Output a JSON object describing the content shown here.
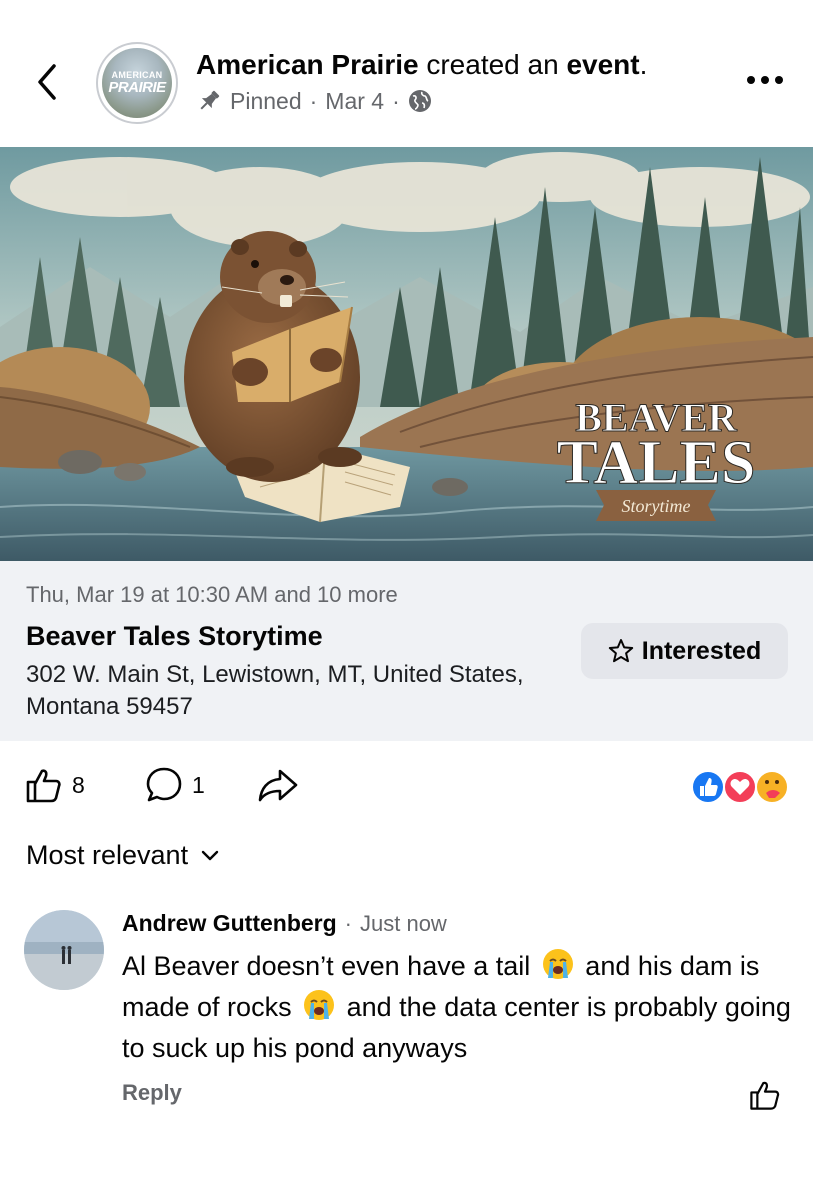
{
  "header": {
    "page_name": "American Prairie",
    "action_text": " created an ",
    "action_object": "event",
    "action_end": ".",
    "avatar_text_top": "AMERICAN",
    "avatar_text_main": "PRAIRIE",
    "pinned_label": "Pinned",
    "date": "Mar 4",
    "separator": "·",
    "privacy_icon": "globe-icon",
    "back_icon": "chevron-left-icon",
    "more_icon": "more-horizontal-icon"
  },
  "banner": {
    "title_line1": "BEAVER",
    "title_line2": "TALES",
    "ribbon_text": "Storytime"
  },
  "event": {
    "date_text": "Thu, Mar 19 at 10:30 AM and 10 more",
    "title": "Beaver Tales Storytime",
    "address": "302 W. Main St, Lewistown, MT, United States, Montana 59457",
    "interested_label": "Interested",
    "interested_icon": "star-outline-icon"
  },
  "actions": {
    "like_count": "8",
    "comment_count": "1",
    "like_icon": "thumbs-up-icon",
    "comment_icon": "comment-bubble-icon",
    "share_icon": "share-arrow-icon",
    "reactions": [
      "like",
      "love",
      "care"
    ]
  },
  "sort": {
    "label": "Most relevant"
  },
  "comment": {
    "author": "Andrew Guttenberg",
    "separator": "·",
    "time": "Just now",
    "text_part1": "Al Beaver doesn’t even have a tail",
    "text_part2": "and his dam is made of rocks",
    "text_part3": "and the data center is probably going to suck up his pond anyways",
    "emoji": "loudly-crying-face",
    "reply_label": "Reply"
  },
  "colors": {
    "secondary_text": "#65676b",
    "card_bg": "#f0f2f5",
    "button_bg": "#e4e6eb",
    "like_blue": "#1877f2",
    "love_red": "#f33e58",
    "care_yellow": "#f7b125"
  }
}
